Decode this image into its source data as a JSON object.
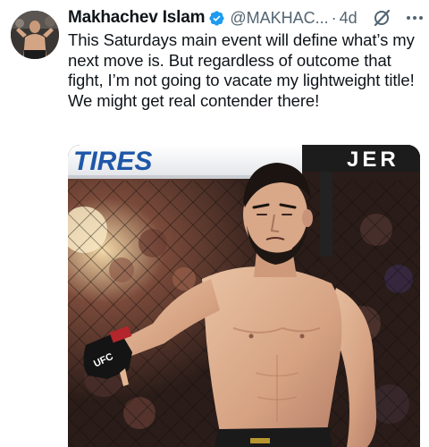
{
  "tweet": {
    "display_name": "Makhachev Islam",
    "handle": "@MAKHAC...",
    "separator": "·",
    "timestamp": "4d",
    "text": "This Saturdays main event will define what’s my next move is. But regardless of outcome that fight, I’m not going to vacate my lightweight title! We might  get real contender there!",
    "verified_color": "#1d9bf0",
    "icons": [
      "verified-badge-icon",
      "grok-icon",
      "more-icon"
    ]
  },
  "media": {
    "banner_left": "TIRES",
    "banner_right": "JER",
    "glove_text": "UFC"
  },
  "colors": {
    "text": "#0f1419",
    "secondary": "#536471",
    "accent": "#1d9bf0"
  }
}
